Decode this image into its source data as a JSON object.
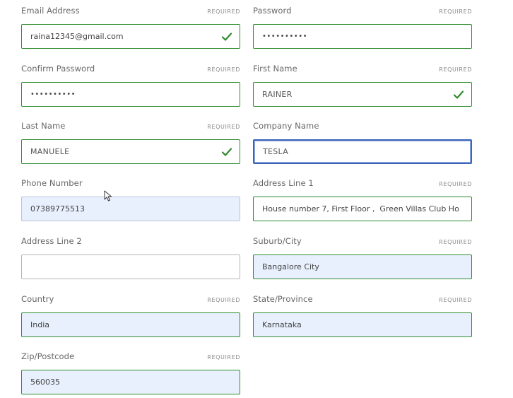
{
  "fields": [
    {
      "key": "email",
      "label": "Email Address",
      "required": "REQUIRED",
      "value": "raina12345@gmail.com",
      "valid": true
    },
    {
      "key": "password",
      "label": "Password",
      "required": "REQUIRED",
      "value": "••••••••••",
      "valid": false
    },
    {
      "key": "confirm_password",
      "label": "Confirm Password",
      "required": "REQUIRED",
      "value": "••••••••••",
      "valid": false
    },
    {
      "key": "first_name",
      "label": "First Name",
      "required": "REQUIRED",
      "value": "RAINER",
      "valid": true
    },
    {
      "key": "last_name",
      "label": "Last Name",
      "required": "REQUIRED",
      "value": "MANUELE",
      "valid": true
    },
    {
      "key": "company_name",
      "label": "Company Name",
      "required": "",
      "value": "TESLA",
      "valid": false
    },
    {
      "key": "phone",
      "label": "Phone Number",
      "required": "",
      "value": "07389775513",
      "valid": false
    },
    {
      "key": "address1",
      "label": "Address Line 1",
      "required": "REQUIRED",
      "value": "House number 7, First Floor ,  Green Villas Club Ho",
      "valid": false
    },
    {
      "key": "address2",
      "label": "Address Line 2",
      "required": "",
      "value": "",
      "valid": false
    },
    {
      "key": "city",
      "label": "Suburb/City",
      "required": "REQUIRED",
      "value": "Bangalore City",
      "valid": false
    },
    {
      "key": "country",
      "label": "Country",
      "required": "REQUIRED",
      "value": "India",
      "valid": false
    },
    {
      "key": "state",
      "label": "State/Province",
      "required": "REQUIRED",
      "value": "Karnataka",
      "valid": false
    },
    {
      "key": "zip",
      "label": "Zip/Postcode",
      "required": "REQUIRED",
      "value": "560035",
      "valid": false
    }
  ],
  "colors": {
    "valid_border": "#2e8b2e",
    "check": "#2e8b2e",
    "autofill_bg": "#e8f0fe",
    "focus_border": "#3a66b8"
  },
  "icons": {
    "valid": "checkmark-icon",
    "pointer": "mouse-cursor-icon"
  }
}
